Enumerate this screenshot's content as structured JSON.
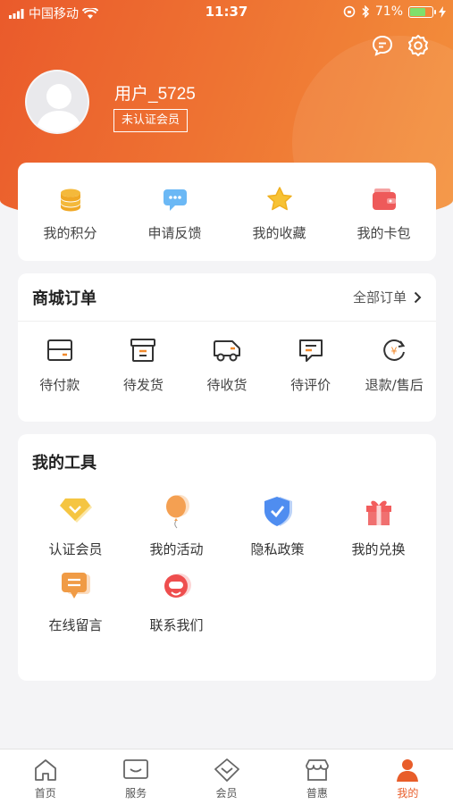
{
  "status_bar": {
    "carrier": "中国移动",
    "time": "11:37",
    "battery": "71%"
  },
  "profile": {
    "username": "用户_5725",
    "badge": "未认证会员"
  },
  "quick_actions": [
    {
      "label": "我的积分",
      "icon": "coins-icon"
    },
    {
      "label": "申请反馈",
      "icon": "feedback-icon"
    },
    {
      "label": "我的收藏",
      "icon": "star-icon"
    },
    {
      "label": "我的卡包",
      "icon": "wallet-icon"
    }
  ],
  "orders": {
    "title": "商城订单",
    "all_label": "全部订单",
    "items": [
      {
        "label": "待付款",
        "icon": "card-icon"
      },
      {
        "label": "待发货",
        "icon": "box-icon"
      },
      {
        "label": "待收货",
        "icon": "truck-icon"
      },
      {
        "label": "待评价",
        "icon": "comment-icon"
      },
      {
        "label": "退款/售后",
        "icon": "refund-icon"
      }
    ]
  },
  "tools": {
    "title": "我的工具",
    "items": [
      {
        "label": "认证会员",
        "icon": "diamond-icon"
      },
      {
        "label": "我的活动",
        "icon": "balloon-icon"
      },
      {
        "label": "隐私政策",
        "icon": "shield-icon"
      },
      {
        "label": "我的兑换",
        "icon": "gift-icon"
      },
      {
        "label": "在线留言",
        "icon": "message-icon"
      },
      {
        "label": "联系我们",
        "icon": "contact-icon"
      }
    ]
  },
  "tab_bar": [
    {
      "label": "首页",
      "icon": "home-icon"
    },
    {
      "label": "服务",
      "icon": "service-icon"
    },
    {
      "label": "会员",
      "icon": "member-icon"
    },
    {
      "label": "普惠",
      "icon": "store-icon"
    },
    {
      "label": "我的",
      "icon": "person-icon",
      "active": true
    }
  ],
  "colors": {
    "accent": "#e85d2a",
    "header_gradient_start": "#ea5a2b",
    "header_gradient_end": "#f3923c"
  }
}
